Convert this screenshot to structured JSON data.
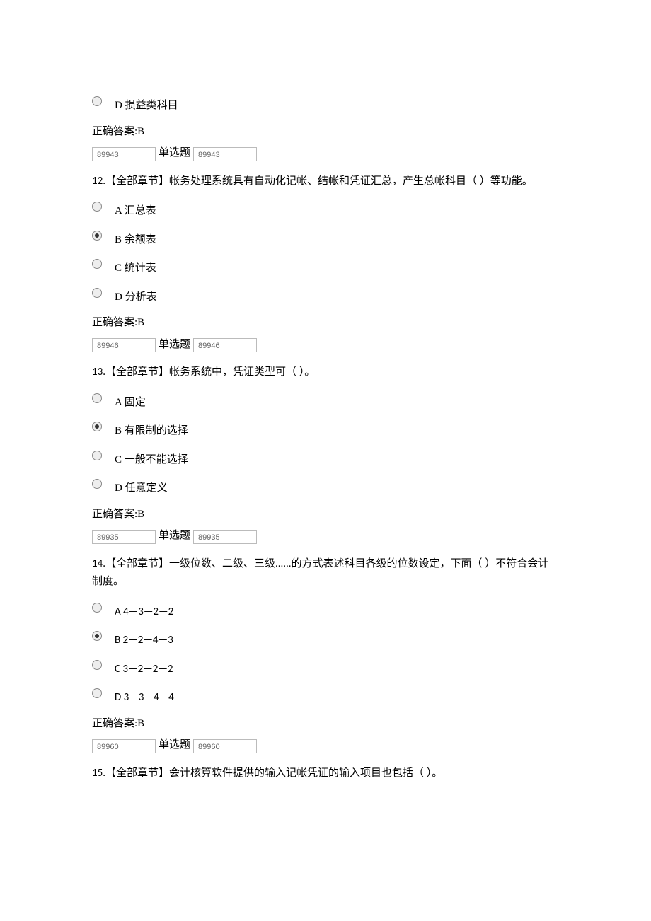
{
  "q11_tail": {
    "optD": "D  损益类科目",
    "answer": "正确答案:B",
    "code1": "89943",
    "label": "单选题",
    "code2": "89943"
  },
  "q12": {
    "num": "12.",
    "text": "【全部章节】帐务处理系统具有自动化记帐、结帐和凭证汇总，产生总帐科目（ ）等功能。",
    "optA": "A  汇总表",
    "optB": "B  余额表",
    "optC": "C  统计表",
    "optD": "D  分析表",
    "answer": "正确答案:B",
    "code1": "89946",
    "label": "单选题",
    "code2": "89946"
  },
  "q13": {
    "num": "13.",
    "text": "【全部章节】帐务系统中，凭证类型可（ ）。",
    "optA": "A  固定",
    "optB": "B  有限制的选择",
    "optC": "C  一般不能选择",
    "optD": "D  任意定义",
    "answer": "正确答案:B",
    "code1": "89935",
    "label": "单选题",
    "code2": "89935"
  },
  "q14": {
    "num": "14.",
    "text": "【全部章节】一级位数、二级、三级......的方式表述科目各级的位数设定，下面（ ）不符合会计制度。",
    "optA": "A 4—3—2—2",
    "optB": "B 2—2—4—3",
    "optC": "C 3—2—2—2",
    "optD": "D 3—3—4—4",
    "answer": "正确答案:B",
    "code1": "89960",
    "label": "单选题",
    "code2": "89960"
  },
  "q15": {
    "num": "15.",
    "text": "【全部章节】会计核算软件提供的输入记帐凭证的输入项目也包括（ ）。"
  }
}
